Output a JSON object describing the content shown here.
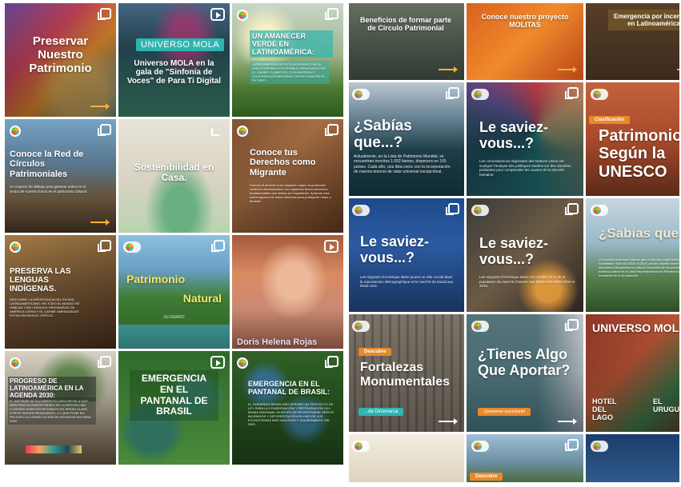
{
  "colors": {
    "teal": "#2fb5b0",
    "orange": "#e8892a",
    "yellow_arrow": "#f2b233",
    "dark_teal": "#0f3d44"
  },
  "left_grid": {
    "tiles": [
      {
        "title": "Preservar Nuestro Patrimonio",
        "body": "",
        "footer": "",
        "icon": "multi-image-icon"
      },
      {
        "pill": "UNIVERSO MOLA",
        "title": "Universo MOLA en la gala de \"Sinfonía de Voces\" de Para Ti Digital",
        "icon": "reel-icon"
      },
      {
        "title": "UN AMANECER VERDE EN LATINOAMÉRICA:",
        "body": "LATINOAMÉRICA SE ESTÁ MOVIENDO HACIA UNA ECONOMÍA SOSTENIBLE, IMPULSADA POR EL CAMBIO CLIMÁTICO, CON ENERGÍA Y COOPERACIÓN REGIONAL DESDE CUBA EN EL FUTURO.",
        "icon": "multi-image-icon"
      },
      {
        "title": "Conoce la Red de Círculos Patrimoniales",
        "body": "Un espacio de diálogo para generar redes en el sector de nuestro fondo en el patrimonio cultural.",
        "icon": "multi-image-icon"
      },
      {
        "title": "Sostenibilidad en Casa.",
        "icon": "multi-image-icon"
      },
      {
        "title": "Conoce tus Derechos como Migrante",
        "body": "Conoce el derecho a la migración según la protección contra la discriminación; los migrantes tienen derechos fundamentales que deben ser respetados. Aprende más sobre algunos de estos derechos para protegerte mejor y también.",
        "icon": "multi-image-icon"
      },
      {
        "title": "PRESERVA LAS LENGUAS INDÍGENAS.",
        "body": "DESCUBRE LA IMPORTANCIA DEL IDIOMA LATINOAMERICANO: EN TODO EL MUNDO SE HABLAN 7.000 LENGUAS ORIGINARIAS DE AMÉRICA LATINA Y EL CARIBE AMENAZADAS ESTÁN EN RIESGO CRÍTICO.",
        "icon": "multi-image-icon"
      },
      {
        "title1": "Patrimonio",
        "title2": "Natural",
        "sub": "GLOSARIO",
        "icon": "multi-image-icon"
      },
      {
        "caption": "Doris Helena Rojas",
        "icon": "reel-icon"
      },
      {
        "title": "PROGRESO DE LATINOAMÉRICA EN LA AGENDA 2030:",
        "body": "EL INFORME DE ELCOMERCIO LINEA REVELA QUE, MIENTRAS ALGUNOS PAÍSES DE LA REGIÓN HAN LOGRADO AVANCES NOTABLES EN ÁREAS CLAVE, OTROS SIGUEN REZAGADOS, LO QUE PONE EN PELIGRO LA CONSECUCIÓN DE ESTAS METAS PARA 2030.",
        "icon": "multi-image-icon"
      },
      {
        "title": "EMERGENCIA EN EL PANTANAL DE BRASIL",
        "icon": "reel-icon"
      },
      {
        "title": "EMERGENCIA EN EL PANTANAL DE BRASIL:",
        "body": "EL GOBIERNO BRASILEÑO APROBÓ UN PROYECTO DE LEY PARA LA CONSERVACIÓN Y RESTAURACIÓN DEL BIOMA PANTANAL DESPUÉS DE REGISTRARSE SERIOS INCENDIOS Y DEFORESTACIÓN EN UNO DE LOS ECOSISTEMAS MÁS VALIOSOS Y VULNERABLES DEL PAÍS.",
        "icon": "multi-image-icon"
      }
    ]
  },
  "right_grid": {
    "tiles": [
      {
        "title": "Beneficios de formar parte de Círculo Patrimonial"
      },
      {
        "title": "Conoce nuestro proyecto MOLITAS"
      },
      {
        "title": "Emergencia por incendios en Latinoamérica"
      },
      {
        "title": "¿Sabías que...?",
        "body": "Actualmente, en la Lista de Patrimonio Mundial, se encuentran inscritos 1.052 bienes, dispersos en 165 países. Cada año, una lista crece con la incorporación de nuevos tesoros de valor universal excepcional."
      },
      {
        "title": "Le saviez-vous...?",
        "body": "Les connaissances régionales des Nations Unies ont souligné l'analyse des politiques basées sur des données probantes pour comprendre les causes de la sécurité humaine."
      },
      {
        "pill": "Clasificación",
        "title": "Patrimonio Según la UNESCO"
      },
      {
        "title": "Le saviez-vous...?",
        "body": "Les migrants d'Amérique latine jouent un rôle crucial dans la reproduction démographique et le marché du travail aux États-Unis."
      },
      {
        "title": "Le saviez-vous...?",
        "body": "Les migrants d'Amérique latine ont comblé 30 % de la population du marché d'œuvre aux États-Unis entre 2000 et 2015."
      },
      {
        "title": "¿Sabías que...?",
        "body": "¿Colombia tiene siete bienes que conforman patrimonios mundiales? Solo en 2019, el 2019, se han inscrito nueve elementos del patrimonio cultural inmaterial de los países de América Latina en la Lista Representativa del Patrimonio Cultural Inmaterial de la Humanidad."
      },
      {
        "pill": "Descubre",
        "title": "Fortalezas Monumentales",
        "foot": "...de Dinamarca"
      },
      {
        "title": "¿Tienes Algo Que Aportar?",
        "pill": "¡Queremos escucharte!"
      },
      {
        "title": "UNIVERSO MOLA",
        "sub1": "HOTEL DEL LAGO",
        "sub2": "EL URUGUAY",
        "side": "20"
      },
      {
        "title": ""
      },
      {
        "pill": "Descubre"
      },
      {
        "title": ""
      }
    ]
  }
}
